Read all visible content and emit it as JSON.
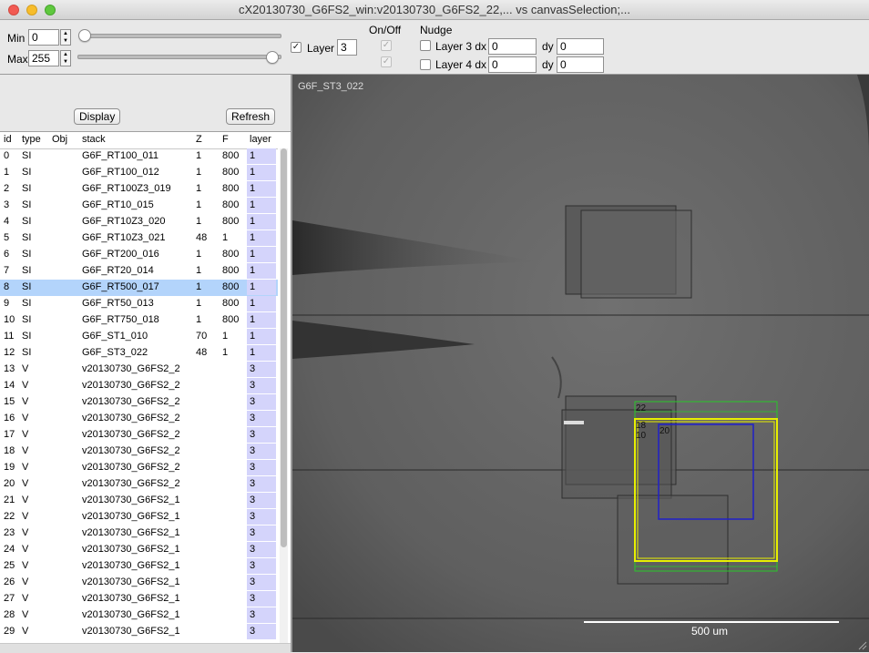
{
  "window": {
    "title": "cX20130730_G6FS2_win:v20130730_G6FS2_22,... vs canvasSelection;..."
  },
  "controls": {
    "min_label": "Min",
    "min_value": "0",
    "max_label": "Max",
    "max_value": "255",
    "min_slider_level": 0,
    "max_slider_level": 1,
    "layer_checkbox_label": "Layer",
    "layer_checked": true,
    "layer_value": "3",
    "onoff_label": "On/Off",
    "nudge_label": "Nudge",
    "nudge_rows": [
      {
        "label": "Layer 3 dx",
        "dx": "0",
        "dy_label": "dy",
        "dy": "0",
        "onoff": true
      },
      {
        "label": "Layer 4 dx",
        "dx": "0",
        "dy_label": "dy",
        "dy": "0",
        "onoff": true
      }
    ]
  },
  "panel": {
    "display_button": "Display",
    "refresh_button": "Refresh"
  },
  "table": {
    "columns": [
      "id",
      "type",
      "Obj",
      "stack",
      "Z",
      "F",
      "layer"
    ],
    "selected_index": 8,
    "rows": [
      {
        "id": "0",
        "type": "SI",
        "obj": "",
        "stack": "G6F_RT100_011",
        "z": "1",
        "f": "800",
        "layer": "1"
      },
      {
        "id": "1",
        "type": "SI",
        "obj": "",
        "stack": "G6F_RT100_012",
        "z": "1",
        "f": "800",
        "layer": "1"
      },
      {
        "id": "2",
        "type": "SI",
        "obj": "",
        "stack": "G6F_RT100Z3_019",
        "z": "1",
        "f": "800",
        "layer": "1"
      },
      {
        "id": "3",
        "type": "SI",
        "obj": "",
        "stack": "G6F_RT10_015",
        "z": "1",
        "f": "800",
        "layer": "1"
      },
      {
        "id": "4",
        "type": "SI",
        "obj": "",
        "stack": "G6F_RT10Z3_020",
        "z": "1",
        "f": "800",
        "layer": "1"
      },
      {
        "id": "5",
        "type": "SI",
        "obj": "",
        "stack": "G6F_RT10Z3_021",
        "z": "48",
        "f": "1",
        "layer": "1"
      },
      {
        "id": "6",
        "type": "SI",
        "obj": "",
        "stack": "G6F_RT200_016",
        "z": "1",
        "f": "800",
        "layer": "1"
      },
      {
        "id": "7",
        "type": "SI",
        "obj": "",
        "stack": "G6F_RT20_014",
        "z": "1",
        "f": "800",
        "layer": "1"
      },
      {
        "id": "8",
        "type": "SI",
        "obj": "",
        "stack": "G6F_RT500_017",
        "z": "1",
        "f": "800",
        "layer": "1"
      },
      {
        "id": "9",
        "type": "SI",
        "obj": "",
        "stack": "G6F_RT50_013",
        "z": "1",
        "f": "800",
        "layer": "1"
      },
      {
        "id": "10",
        "type": "SI",
        "obj": "",
        "stack": "G6F_RT750_018",
        "z": "1",
        "f": "800",
        "layer": "1"
      },
      {
        "id": "11",
        "type": "SI",
        "obj": "",
        "stack": "G6F_ST1_010",
        "z": "70",
        "f": "1",
        "layer": "1"
      },
      {
        "id": "12",
        "type": "SI",
        "obj": "",
        "stack": "G6F_ST3_022",
        "z": "48",
        "f": "1",
        "layer": "1"
      },
      {
        "id": "13",
        "type": "V",
        "obj": "",
        "stack": "v20130730_G6FS2_2",
        "z": "",
        "f": "",
        "layer": "3"
      },
      {
        "id": "14",
        "type": "V",
        "obj": "",
        "stack": "v20130730_G6FS2_2",
        "z": "",
        "f": "",
        "layer": "3"
      },
      {
        "id": "15",
        "type": "V",
        "obj": "",
        "stack": "v20130730_G6FS2_2",
        "z": "",
        "f": "",
        "layer": "3"
      },
      {
        "id": "16",
        "type": "V",
        "obj": "",
        "stack": "v20130730_G6FS2_2",
        "z": "",
        "f": "",
        "layer": "3"
      },
      {
        "id": "17",
        "type": "V",
        "obj": "",
        "stack": "v20130730_G6FS2_2",
        "z": "",
        "f": "",
        "layer": "3"
      },
      {
        "id": "18",
        "type": "V",
        "obj": "",
        "stack": "v20130730_G6FS2_2",
        "z": "",
        "f": "",
        "layer": "3"
      },
      {
        "id": "19",
        "type": "V",
        "obj": "",
        "stack": "v20130730_G6FS2_2",
        "z": "",
        "f": "",
        "layer": "3"
      },
      {
        "id": "20",
        "type": "V",
        "obj": "",
        "stack": "v20130730_G6FS2_2",
        "z": "",
        "f": "",
        "layer": "3"
      },
      {
        "id": "21",
        "type": "V",
        "obj": "",
        "stack": "v20130730_G6FS2_1",
        "z": "",
        "f": "",
        "layer": "3"
      },
      {
        "id": "22",
        "type": "V",
        "obj": "",
        "stack": "v20130730_G6FS2_1",
        "z": "",
        "f": "",
        "layer": "3"
      },
      {
        "id": "23",
        "type": "V",
        "obj": "",
        "stack": "v20130730_G6FS2_1",
        "z": "",
        "f": "",
        "layer": "3"
      },
      {
        "id": "24",
        "type": "V",
        "obj": "",
        "stack": "v20130730_G6FS2_1",
        "z": "",
        "f": "",
        "layer": "3"
      },
      {
        "id": "25",
        "type": "V",
        "obj": "",
        "stack": "v20130730_G6FS2_1",
        "z": "",
        "f": "",
        "layer": "3"
      },
      {
        "id": "26",
        "type": "V",
        "obj": "",
        "stack": "v20130730_G6FS2_1",
        "z": "",
        "f": "",
        "layer": "3"
      },
      {
        "id": "27",
        "type": "V",
        "obj": "",
        "stack": "v20130730_G6FS2_1",
        "z": "",
        "f": "",
        "layer": "3"
      },
      {
        "id": "28",
        "type": "V",
        "obj": "",
        "stack": "v20130730_G6FS2_1",
        "z": "",
        "f": "",
        "layer": "3"
      },
      {
        "id": "29",
        "type": "V",
        "obj": "",
        "stack": "v20130730_G6FS2_1",
        "z": "",
        "f": "",
        "layer": "3"
      }
    ]
  },
  "canvas": {
    "image_label": "G6F_ST3_022",
    "scale_bar_label": "500 um",
    "overlay_labels": [
      "22",
      "18",
      "10",
      "20"
    ],
    "colors": {
      "selection_yellow": "#e8f000",
      "frame_green": "#28c828",
      "frame_blue": "#2020c8",
      "frame_dark": "#3a3a3a"
    }
  }
}
